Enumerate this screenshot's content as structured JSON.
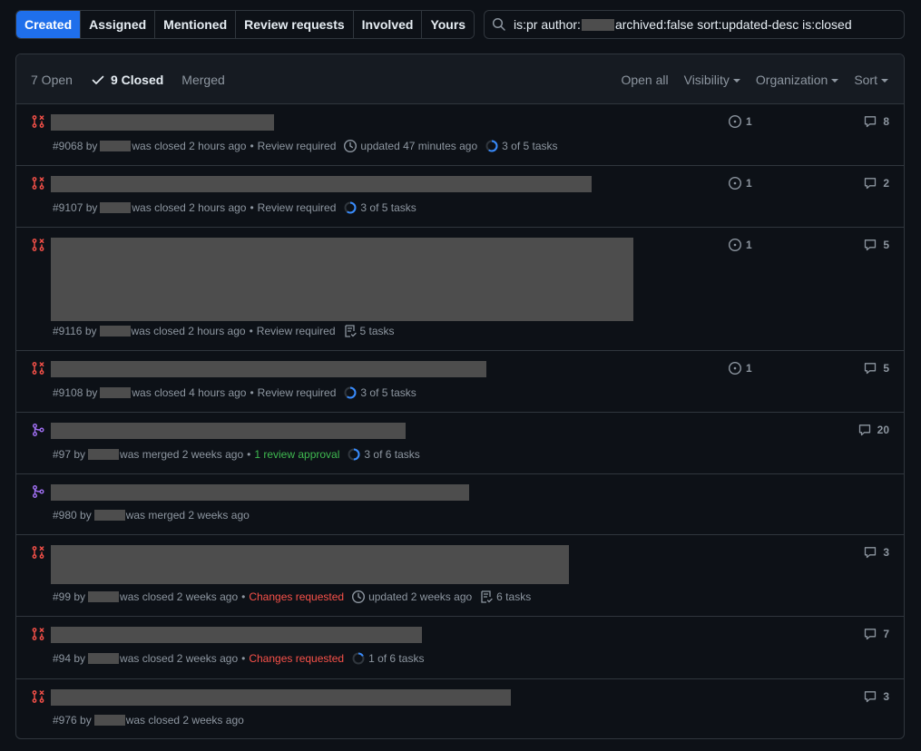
{
  "tabs": [
    "Created",
    "Assigned",
    "Mentioned",
    "Review requests",
    "Involved",
    "Yours"
  ],
  "search": {
    "prefix": "is:pr author:",
    "suffix": "archived:false sort:updated-desc is:closed"
  },
  "states": {
    "open": "7 Open",
    "closed": "9 Closed",
    "merged": "Merged"
  },
  "filters": {
    "open_all": "Open all",
    "visibility": "Visibility",
    "organization": "Organization",
    "sort": "Sort"
  },
  "colors": {
    "closed": "#f85149",
    "merged": "#a371f7",
    "accent": "#1f6feb",
    "review_ok": "#3fb950"
  },
  "rows": [
    {
      "kind": "closed",
      "number": "#9068",
      "by": "by",
      "status": "was closed 2 hours ago",
      "review": "Review required",
      "review_style": "muted",
      "updated": "updated 47 minutes ago",
      "tasks": "3 of 5 tasks",
      "task_progress": 0.6,
      "issues": "1",
      "comments": "8"
    },
    {
      "kind": "closed",
      "number": "#9107",
      "by": "by",
      "status": "was closed 2 hours ago",
      "review": "Review required",
      "review_style": "muted",
      "updated": "",
      "tasks": "3 of 5 tasks",
      "task_progress": 0.6,
      "issues": "1",
      "comments": "2"
    },
    {
      "kind": "closed",
      "number": "#9116",
      "by": "by",
      "status": "was closed 2 hours ago",
      "review": "Review required",
      "review_style": "muted",
      "updated": "",
      "tasks": "5 tasks",
      "task_progress": null,
      "issues": "1",
      "comments": "5"
    },
    {
      "kind": "closed",
      "number": "#9108",
      "by": "by",
      "status": "was closed 4 hours ago",
      "review": "Review required",
      "review_style": "muted",
      "updated": "",
      "tasks": "3 of 5 tasks",
      "task_progress": 0.6,
      "issues": "1",
      "comments": "5"
    },
    {
      "kind": "merged",
      "number": "#97",
      "by": "by",
      "status": "was merged 2 weeks ago",
      "review": "1 review approval",
      "review_style": "green",
      "updated": "",
      "tasks": "3 of 6 tasks",
      "task_progress": 0.5,
      "issues": "",
      "comments": "20"
    },
    {
      "kind": "merged",
      "number": "#980",
      "by": "by",
      "status": "was merged 2 weeks ago",
      "review": "",
      "review_style": "muted",
      "updated": "",
      "tasks": "",
      "task_progress": null,
      "issues": "",
      "comments": ""
    },
    {
      "kind": "closed",
      "number": "#99",
      "by": "by",
      "status": "was closed 2 weeks ago",
      "review": "Changes requested",
      "review_style": "red",
      "updated": "updated 2 weeks ago",
      "tasks": "6 tasks",
      "task_progress": null,
      "issues": "",
      "comments": "3"
    },
    {
      "kind": "closed",
      "number": "#94",
      "by": "by",
      "status": "was closed 2 weeks ago",
      "review": "Changes requested",
      "review_style": "red",
      "updated": "",
      "tasks": "1 of 6 tasks",
      "task_progress": 0.17,
      "issues": "",
      "comments": "7"
    },
    {
      "kind": "closed",
      "number": "#976",
      "by": "by",
      "status": "was closed 2 weeks ago",
      "review": "",
      "review_style": "muted",
      "updated": "",
      "tasks": "",
      "task_progress": null,
      "issues": "",
      "comments": "3"
    }
  ]
}
